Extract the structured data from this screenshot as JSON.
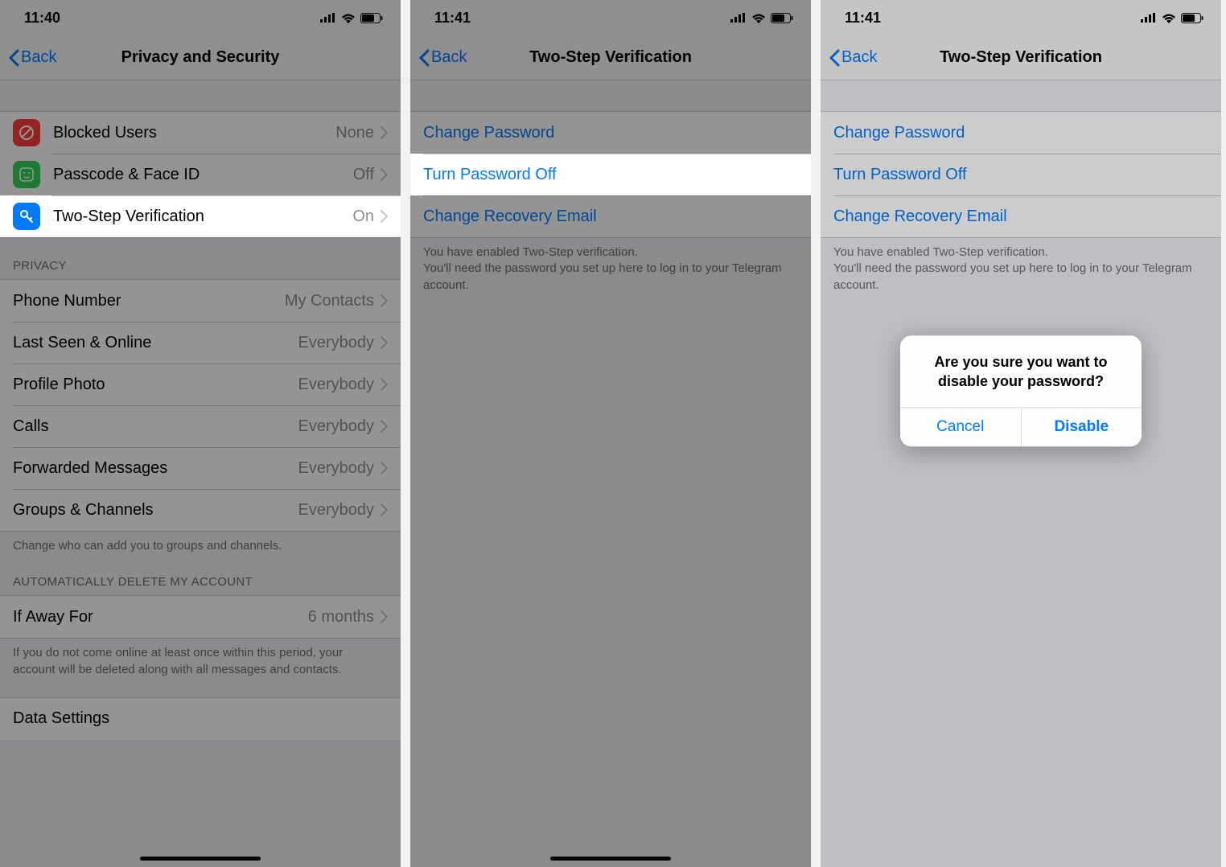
{
  "screen1": {
    "time": "11:40",
    "back": "Back",
    "title": "Privacy and Security",
    "rows_security": [
      {
        "label": "Blocked Users",
        "value": "None",
        "icon": "blocked",
        "color": "#fc3d39"
      },
      {
        "label": "Passcode & Face ID",
        "value": "Off",
        "icon": "faceid",
        "color": "#30d158"
      },
      {
        "label": "Two-Step Verification",
        "value": "On",
        "icon": "key",
        "color": "#007aff"
      }
    ],
    "privacy_header": "PRIVACY",
    "rows_privacy": [
      {
        "label": "Phone Number",
        "value": "My Contacts"
      },
      {
        "label": "Last Seen & Online",
        "value": "Everybody"
      },
      {
        "label": "Profile Photo",
        "value": "Everybody"
      },
      {
        "label": "Calls",
        "value": "Everybody"
      },
      {
        "label": "Forwarded Messages",
        "value": "Everybody"
      },
      {
        "label": "Groups & Channels",
        "value": "Everybody"
      }
    ],
    "privacy_footer": "Change who can add you to groups and channels.",
    "delete_header": "AUTOMATICALLY DELETE MY ACCOUNT",
    "delete_row": {
      "label": "If Away For",
      "value": "6 months"
    },
    "delete_footer": "If you do not come online at least once within this period, your account will be deleted along with all messages and contacts.",
    "data_settings_label": "Data Settings"
  },
  "screen2": {
    "time": "11:41",
    "back": "Back",
    "title": "Two-Step Verification",
    "links": [
      "Change Password",
      "Turn Password Off",
      "Change Recovery Email"
    ],
    "footer": "You have enabled Two-Step verification.\nYou'll need the password you set up here to log in to your Telegram account."
  },
  "screen3": {
    "time": "11:41",
    "back": "Back",
    "title": "Two-Step Verification",
    "links": [
      "Change Password",
      "Turn Password Off",
      "Change Recovery Email"
    ],
    "footer": "You have enabled Two-Step verification.\nYou'll need the password you set up here to log in to your Telegram account.",
    "alert": {
      "message": "Are you sure you want to disable your password?",
      "cancel": "Cancel",
      "confirm": "Disable"
    }
  }
}
